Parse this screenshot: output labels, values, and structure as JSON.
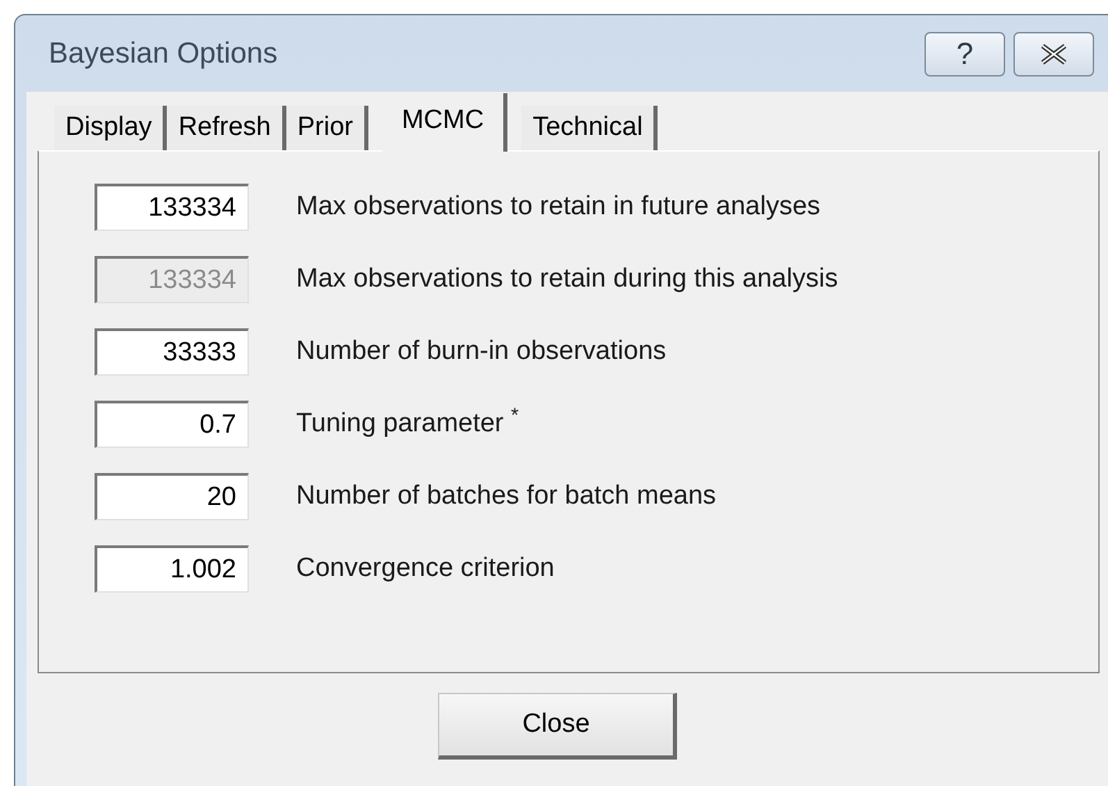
{
  "window": {
    "title": "Bayesian Options",
    "buttons": [
      {
        "kind": "help",
        "label": "?"
      },
      {
        "kind": "close"
      }
    ]
  },
  "tabs": [
    {
      "label": "Display",
      "selected": false
    },
    {
      "label": "Refresh",
      "selected": false
    },
    {
      "label": "Prior",
      "selected": false
    },
    {
      "label": "MCMC",
      "selected": true
    },
    {
      "label": "Technical",
      "selected": false
    }
  ],
  "fields": [
    {
      "value": "133334",
      "label": "Max observations to retain in future analyses",
      "disabled": false
    },
    {
      "value": "133334",
      "label": "Max observations to retain during this analysis",
      "disabled": true
    },
    {
      "value": "33333",
      "label": "Number of burn-in observations",
      "disabled": false
    },
    {
      "value": "0.7",
      "label": "Tuning parameter $^{*}$",
      "disabled": false
    },
    {
      "value": "20",
      "label": "Number of batches for batch means",
      "disabled": false
    },
    {
      "value": "1.002",
      "label": "Convergence criterion",
      "disabled": false
    }
  ],
  "buttons": [
    "Close"
  ]
}
